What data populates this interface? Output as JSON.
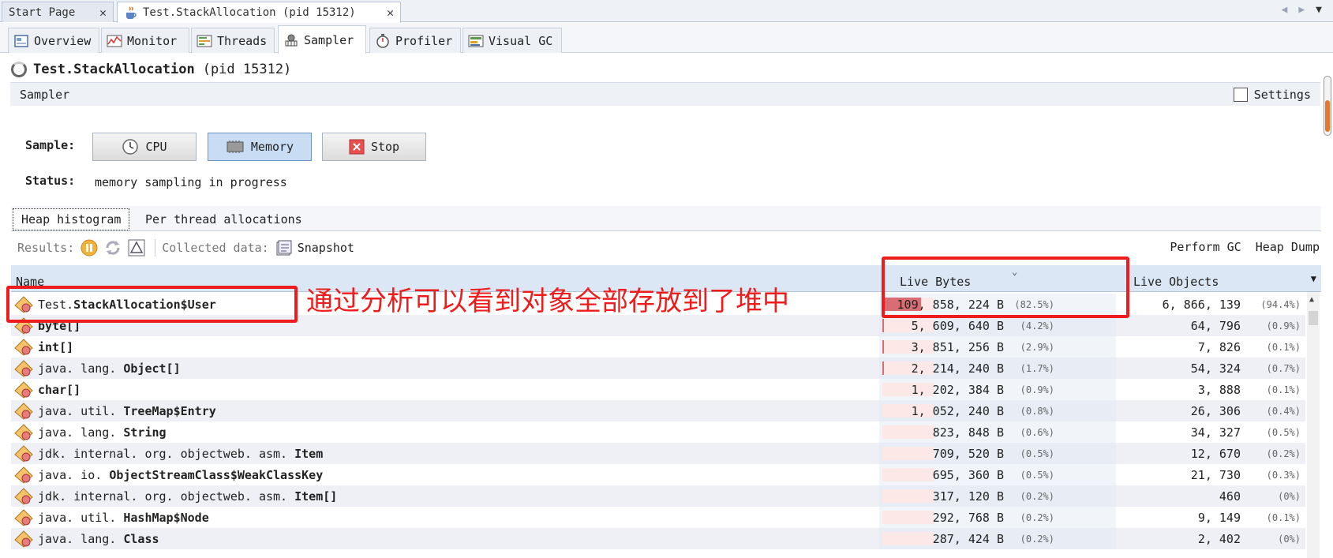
{
  "doc_tabs": [
    {
      "label": "Start Page",
      "close": "✕"
    },
    {
      "label": "Test.StackAllocation (pid 15312)",
      "close": "✕"
    }
  ],
  "tool_tabs": [
    "Overview",
    "Monitor",
    "Threads",
    "Sampler",
    "Profiler",
    "Visual GC"
  ],
  "process": {
    "name": "Test.StackAllocation",
    "pid": "(pid 15312)"
  },
  "sampler": {
    "title": "Sampler",
    "settings_label": "Settings",
    "sample_label": "Sample:",
    "buttons": {
      "cpu": "CPU",
      "memory": "Memory",
      "stop": "Stop"
    },
    "status_label": "Status:",
    "status_value": "memory sampling in progress"
  },
  "subtabs": [
    "Heap histogram",
    "Per thread allocations"
  ],
  "results": {
    "results_label": "Results:",
    "collected_label": "Collected data:",
    "snapshot_label": "Snapshot",
    "perform_gc": "Perform GC",
    "heap_dump": "Heap Dump"
  },
  "table": {
    "columns": {
      "name": "Name",
      "live_bytes": "Live Bytes",
      "live_objects": "Live Objects"
    },
    "rows": [
      {
        "pkg": "Test.",
        "cls": "StackAllocation$User",
        "bytes": "109, 858, 224 B",
        "bytes_pct": "(82.5%)",
        "bar": 0.825,
        "objects": "6, 866, 139",
        "objects_pct": "(94.4%)"
      },
      {
        "pkg": "",
        "cls": "byte[]",
        "bytes": "5, 609, 640 B",
        "bytes_pct": "(4.2%)",
        "bar": 0.042,
        "objects": "64, 796",
        "objects_pct": "(0.9%)"
      },
      {
        "pkg": "",
        "cls": "int[]",
        "bytes": "3, 851, 256 B",
        "bytes_pct": "(2.9%)",
        "bar": 0.029,
        "objects": "7, 826",
        "objects_pct": "(0.1%)"
      },
      {
        "pkg": "java. lang. ",
        "cls": "Object[]",
        "bytes": "2, 214, 240 B",
        "bytes_pct": "(1.7%)",
        "bar": 0.017,
        "objects": "54, 324",
        "objects_pct": "(0.7%)"
      },
      {
        "pkg": "",
        "cls": "char[]",
        "bytes": "1, 202, 384 B",
        "bytes_pct": "(0.9%)",
        "bar": 0.009,
        "objects": "3, 888",
        "objects_pct": "(0.1%)"
      },
      {
        "pkg": "java. util. ",
        "cls": "TreeMap$Entry",
        "bytes": "1, 052, 240 B",
        "bytes_pct": "(0.8%)",
        "bar": 0.008,
        "objects": "26, 306",
        "objects_pct": "(0.4%)"
      },
      {
        "pkg": "java. lang. ",
        "cls": "String",
        "bytes": "823, 848 B",
        "bytes_pct": "(0.6%)",
        "bar": 0.006,
        "objects": "34, 327",
        "objects_pct": "(0.5%)"
      },
      {
        "pkg": "jdk. internal. org. objectweb. asm. ",
        "cls": "Item",
        "bytes": "709, 520 B",
        "bytes_pct": "(0.5%)",
        "bar": 0.005,
        "objects": "12, 670",
        "objects_pct": "(0.2%)"
      },
      {
        "pkg": "java. io. ",
        "cls": "ObjectStreamClass$WeakClassKey",
        "bytes": "695, 360 B",
        "bytes_pct": "(0.5%)",
        "bar": 0.005,
        "objects": "21, 730",
        "objects_pct": "(0.3%)"
      },
      {
        "pkg": "jdk. internal. org. objectweb. asm. ",
        "cls": "Item[]",
        "bytes": "317, 120 B",
        "bytes_pct": "(0.2%)",
        "bar": 0.002,
        "objects": "460",
        "objects_pct": "(0%)"
      },
      {
        "pkg": "java. util. ",
        "cls": "HashMap$Node",
        "bytes": "292, 768 B",
        "bytes_pct": "(0.2%)",
        "bar": 0.002,
        "objects": "9, 149",
        "objects_pct": "(0.1%)"
      },
      {
        "pkg": "java. lang. ",
        "cls": "Class",
        "bytes": "287, 424 B",
        "bytes_pct": "(0.2%)",
        "bar": 0.002,
        "objects": "2, 402",
        "objects_pct": "(0%)"
      }
    ]
  },
  "annotation": {
    "text": "通过分析可以看到对象全部存放到了堆中",
    "color": "#ee1c1c"
  },
  "colors": {
    "bar": "#d86e73",
    "bar_bg": "#fde8e8",
    "header": "#dbe7f5"
  }
}
